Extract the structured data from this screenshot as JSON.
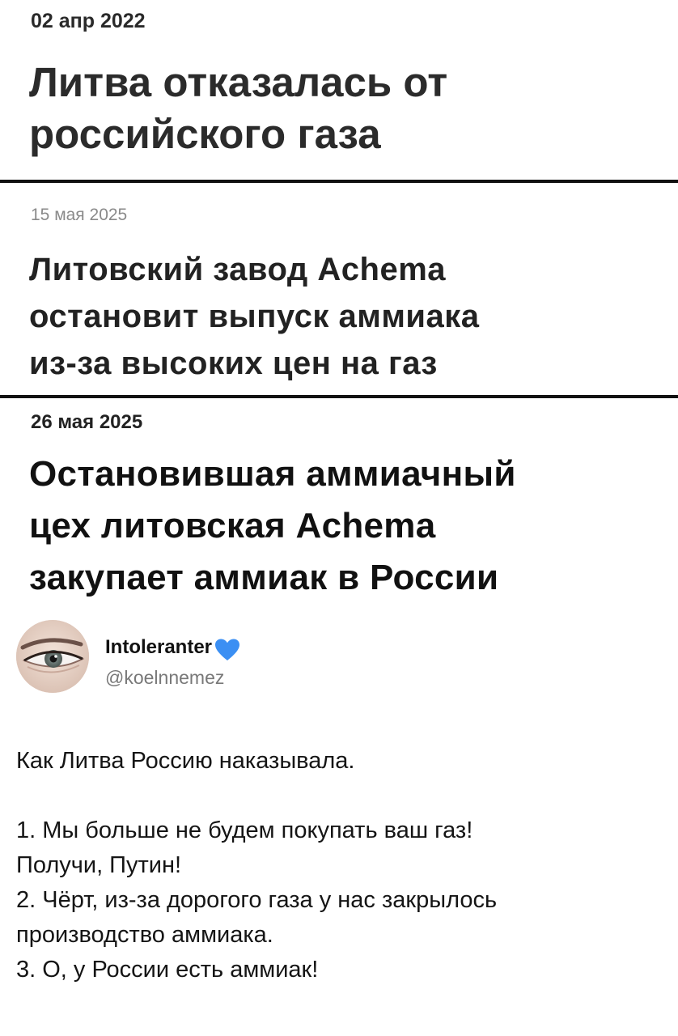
{
  "panels": [
    {
      "date": "02 апр 2022",
      "headline_lines": [
        "Литва отказалась от",
        "российского газа"
      ]
    },
    {
      "date": "15 мая 2025",
      "headline_lines": [
        "Литовский завод Achema",
        "остановит выпуск аммиака",
        "из-за высоких цен на газ"
      ]
    },
    {
      "date": "26 мая 2025",
      "headline_lines": [
        "Остановившая аммиачный",
        "цех литовская Achema",
        "закупает аммиак в России"
      ]
    }
  ],
  "tweet": {
    "author_name": "Intoleranter",
    "name_icon": "blue-heart-icon",
    "handle": "@koelnnemez",
    "avatar_icon": "eye-closeup-avatar",
    "lines": [
      "Как Литва Россию наказывала.",
      "",
      "1. Мы больше не будем покупать ваш газ!",
      "Получи, Путин!",
      "2. Чёрт, из-за дорогого газа у нас закрылось",
      "производство аммиака.",
      "3. О, у России есть аммиак!"
    ]
  },
  "colors": {
    "divider": "#111111",
    "heart": "#3b8ff3",
    "handle": "#787878"
  }
}
